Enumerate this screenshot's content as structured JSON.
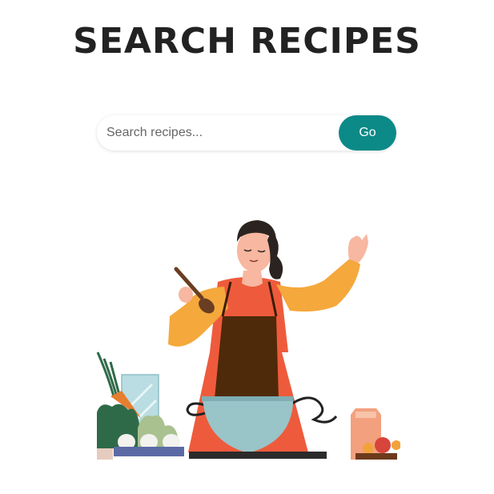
{
  "header": {
    "title": "SEARCH RECIPES"
  },
  "search": {
    "placeholder": "Search recipes...",
    "value": "",
    "button_label": "Go"
  },
  "illustration": {
    "subject": "woman-cooking",
    "colors": {
      "accent": "#0c8a88",
      "apron": "#4e2a0a",
      "shirt": "#f5a83b",
      "dress": "#ee5b3c",
      "bowl": "#99c4c8"
    }
  }
}
